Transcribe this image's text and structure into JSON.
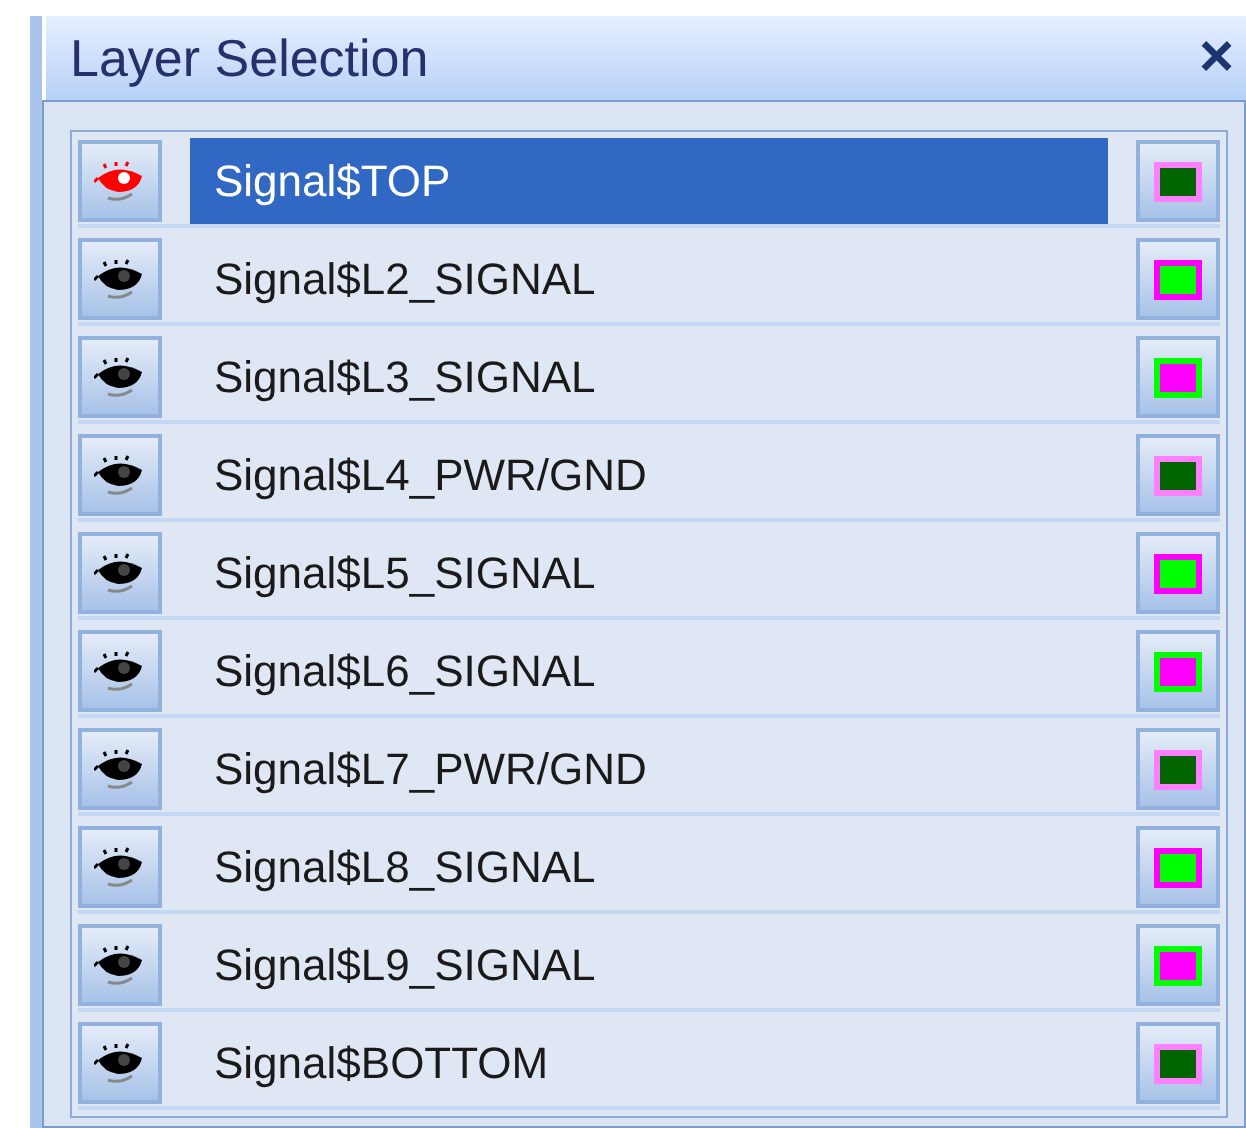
{
  "panel": {
    "title": "Layer Selection",
    "close": "×"
  },
  "layers": [
    {
      "name": "Signal$TOP",
      "selected": true,
      "color": "#006400",
      "outline": {
        "color": "#ff80ff"
      }
    },
    {
      "name": "Signal$L2_SIGNAL",
      "selected": false,
      "color": "#00ff00",
      "outline": {
        "color": "#ff00ff"
      }
    },
    {
      "name": "Signal$L3_SIGNAL",
      "selected": false,
      "color": "#ff00ff",
      "outline": {
        "color": "#00ff00"
      }
    },
    {
      "name": "Signal$L4_PWR/GND",
      "selected": false,
      "color": "#006400",
      "outline": {
        "color": "#ff80ff"
      }
    },
    {
      "name": "Signal$L5_SIGNAL",
      "selected": false,
      "color": "#00ff00",
      "outline": {
        "color": "#ff00ff"
      }
    },
    {
      "name": "Signal$L6_SIGNAL",
      "selected": false,
      "color": "#ff00ff",
      "outline": {
        "color": "#00ff00"
      }
    },
    {
      "name": "Signal$L7_PWR/GND",
      "selected": false,
      "color": "#006400",
      "outline": {
        "color": "#ff80ff"
      }
    },
    {
      "name": "Signal$L8_SIGNAL",
      "selected": false,
      "color": "#00ff00",
      "outline": {
        "color": "#ff00ff"
      }
    },
    {
      "name": "Signal$L9_SIGNAL",
      "selected": false,
      "color": "#ff00ff",
      "outline": {
        "color": "#00ff00"
      }
    },
    {
      "name": "Signal$BOTTOM",
      "selected": false,
      "color": "#006400",
      "outline": {
        "color": "#ff80ff"
      }
    }
  ]
}
